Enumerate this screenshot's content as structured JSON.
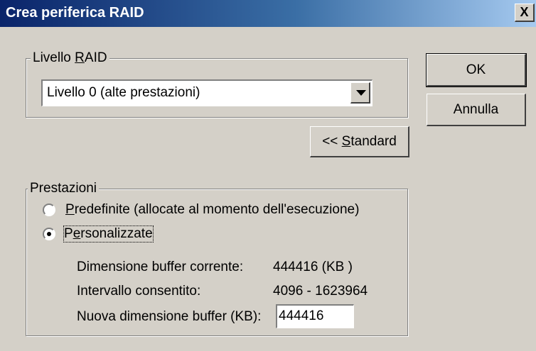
{
  "window": {
    "title": "Crea periferica RAID",
    "close_label": "X"
  },
  "raid_group": {
    "legend_pre": "Livello ",
    "legend_mn": "R",
    "legend_post": "AID",
    "selected": "Livello 0 (alte prestazioni)"
  },
  "buttons": {
    "ok": "OK",
    "cancel": "Annulla",
    "standard_pre": "<< ",
    "standard_mn": "S",
    "standard_post": "tandard"
  },
  "perf_group": {
    "legend": "Prestazioni",
    "opt_default_mn": "P",
    "opt_default_rest": "redefinite (allocate al momento dell'esecuzione)",
    "opt_custom_pre": "P",
    "opt_custom_mn": "e",
    "opt_custom_post": "rsonalizzate",
    "selected_option": "Personalizzate",
    "current_label": "Dimensione buffer corrente:",
    "current_value": "444416 (KB )",
    "range_label": "Intervallo consentito:",
    "range_value": "4096 - 1623964",
    "new_label": "Nuova dimensione buffer (KB):",
    "new_value": "444416"
  }
}
